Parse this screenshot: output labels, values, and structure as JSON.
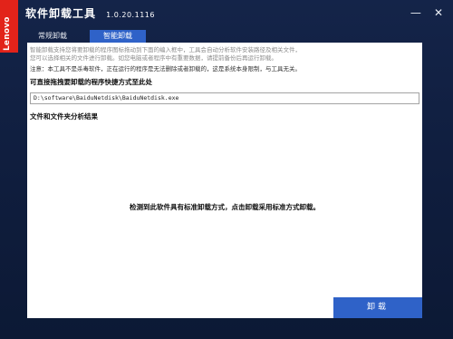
{
  "brand": {
    "logo_text": "Lenovo"
  },
  "window": {
    "title": "软件卸载工具",
    "version": "1.0.20.1116",
    "minimize_symbol": "—",
    "close_symbol": "✕"
  },
  "tabs": [
    {
      "label": "常规卸载",
      "active": false
    },
    {
      "label": "智能卸载",
      "active": true
    }
  ],
  "content": {
    "hint_line1": "智能卸载支持您将要卸载的程序图标拖动到下面的编入框中，工具会自动分析软件安装路径及相关文件，",
    "hint_line2": "您可以选择相关的文件进行卸载。如您电脑或者程序中有重要数据，请提前备份后再运行卸载。",
    "note": "注意：本工具不是杀毒软件，正在运行的程序是无法删除或者卸载的，这是系统本身限制，与工具无关。",
    "drag_label": "可直接拖拽要卸载的程序快捷方式至此处",
    "path_value": "D:\\software\\BaiduNetdisk\\BaiduNetdisk.exe",
    "section_label": "文件和文件夹分析结果",
    "result_message": "检测到此软件具有标准卸载方式，点击卸载采用标准方式卸载。"
  },
  "actions": {
    "uninstall_label": "卸载"
  },
  "colors": {
    "window_bg": "#122246",
    "accent_blue": "#2f62c8",
    "brand_red": "#e2231a",
    "panel_bg": "#ffffff"
  }
}
